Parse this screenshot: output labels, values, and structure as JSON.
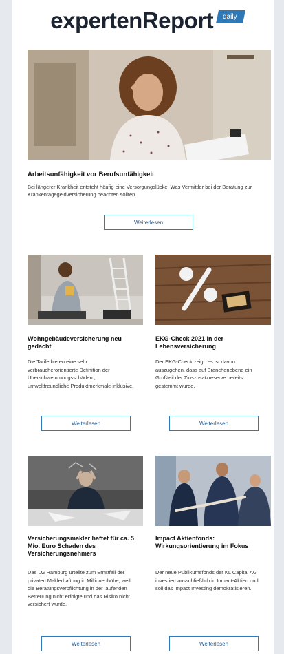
{
  "header": {
    "logo_text": "expertenReport",
    "badge": "daily",
    "brand_color": "#2f78b7"
  },
  "lead": {
    "title": "Arbeitsunfähigkeit vor Berufsunfähigkeit",
    "text": "Bei längerer Krankheit entsteht häufig eine Versorgungslücke. Was Vermittler bei der Beratung zur Krankentagegeldversicherung beachten sollten.",
    "button": "Weiterlesen"
  },
  "articles": [
    {
      "title": "Wohngebäudeversicherung neu gedacht",
      "text": "Die Tarife bieten eine sehr verbraucherorientierte Definition der Überschwemmungsschäden , umweltfreundliche Produktmerkmale inklusive.",
      "button": "Weiterlesen"
    },
    {
      "title": "EKG-Check 2021 in der Lebensversicherung",
      "text": "Der EKG-Check zeigt: es ist davon auszugehen, dass auf Branchenebene ein Großteil der Zinszusatzreserve bereits gestemmt wurde.",
      "button": "Weiterlesen"
    },
    {
      "title": "Versicherungsmakler haftet für ca. 5 Mio. Euro Schaden des Versicherungsnehmers",
      "text": "Das LG Hamburg urteilte zum Ernstfall der privaten Maklerhaftung in Millionenhöhe, weil die Beratungsverpflichtung in der laufenden Betreuung nicht erfolgte und das Risiko nicht versichert wurde.",
      "button": "Weiterlesen"
    },
    {
      "title": "Impact Aktienfonds: Wirkungsorientierung im Fokus",
      "text": "Der neue Publikumsfonds der KL Capital AG investiert ausschließlich in Impact-Aktien und soll das Impact Investing demokratisieren.",
      "button": "Weiterlesen"
    }
  ]
}
